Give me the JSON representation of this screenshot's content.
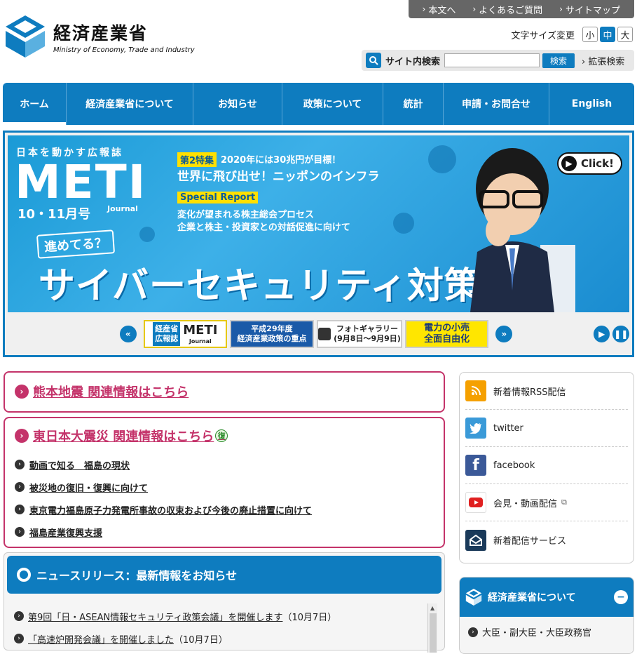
{
  "util": {
    "links": [
      "本文へ",
      "よくあるご質問",
      "サイトマップ"
    ]
  },
  "logo": {
    "name_jp": "経済産業省",
    "name_en": "Ministry of Economy, Trade and Industry"
  },
  "font_size": {
    "label": "文字サイズ変更",
    "small": "小",
    "medium": "中",
    "large": "大",
    "selected": "中"
  },
  "search": {
    "label": "サイト内検索",
    "value": "",
    "placeholder": "",
    "button": "検索",
    "advanced": "拡張検索"
  },
  "nav": {
    "items": [
      "ホーム",
      "経済産業省について",
      "お知らせ",
      "政策について",
      "統計",
      "申請・お問合せ",
      "English"
    ],
    "active": "ホーム"
  },
  "banner": {
    "mag_subtitle": "日本を動かす広報誌",
    "mag_title": "METI",
    "mag_journal": "Journal",
    "mag_issue": "10・11月号",
    "feature_tag": "第2特集",
    "feature_line1": "2020年には30兆円が目標！",
    "feature_line2": "世界に飛び出せ！ニッポンのインフラ",
    "special_tag": "Special Report",
    "special_line1": "変化が望まれる株主総会プロセス",
    "special_line2": "企業と株主・投資家との対話促進に向けて",
    "catch": "進めてる？",
    "headline": "サイバーセキュリティ対策",
    "click": "Click!"
  },
  "carousel": {
    "thumb1_left": "経産省\n広報誌",
    "thumb1_right": "METI",
    "thumb1_journal": "Journal",
    "thumb2": "平成29年度\n経済産業政策の重点",
    "thumb3": "フォトギャラリー\n(9月8日〜9月9日)",
    "thumb4": "電力の小売\n全面自由化"
  },
  "alerts": {
    "kumamoto": "熊本地震 関連情報はこちら",
    "higashi": "東日本大震災 関連情報はこちら",
    "fukkou": "復",
    "sublinks": [
      "動画で知る　福島の現状",
      "被災地の復旧・復興に向けて",
      "東京電力福島原子力発電所事故の収束および今後の廃止措置に向けて",
      "福島産業復興支援"
    ]
  },
  "news": {
    "header": "ニュースリリース：最新情報をお知らせ",
    "items": [
      {
        "title": "第9回「日・ASEAN情報セキュリティ政策会議」を開催します",
        "date": "（10月7日）"
      },
      {
        "title": "「高速炉開発会議」を開催しました",
        "date": "（10月7日）"
      }
    ]
  },
  "social": {
    "items": [
      "新着情報RSS配信",
      "twitter",
      "facebook",
      "会見・動画配信",
      "新着配信サービス"
    ]
  },
  "about": {
    "header": "経済産業省について",
    "items": [
      "大臣・副大臣・大臣政務官"
    ]
  },
  "colors": {
    "primary": "#0e7cbf",
    "alert": "#c4336a",
    "util_bar": "#666666"
  }
}
